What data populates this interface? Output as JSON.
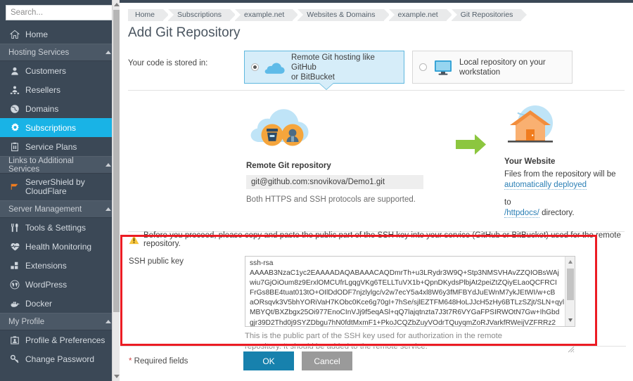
{
  "sidebar": {
    "search": {
      "placeholder": "Search...",
      "value": ""
    },
    "items": [
      {
        "type": "item",
        "label": "Home",
        "icon": "home-icon",
        "active": false
      },
      {
        "type": "group",
        "label": "Hosting Services",
        "icon": "chevron-up-icon"
      },
      {
        "type": "item",
        "label": "Customers",
        "icon": "user-icon",
        "active": false
      },
      {
        "type": "item",
        "label": "Resellers",
        "icon": "users-icon",
        "active": false
      },
      {
        "type": "item",
        "label": "Domains",
        "icon": "globe-icon",
        "active": false
      },
      {
        "type": "item",
        "label": "Subscriptions",
        "icon": "gear-icon",
        "active": true
      },
      {
        "type": "item",
        "label": "Service Plans",
        "icon": "clipboard-icon",
        "active": false
      },
      {
        "type": "group",
        "label": "Links to Additional Services",
        "icon": "chevron-up-icon"
      },
      {
        "type": "item",
        "label": "ServerShield by CloudFlare",
        "icon": "flag-icon",
        "active": false
      },
      {
        "type": "group",
        "label": "Server Management",
        "icon": "chevron-up-icon"
      },
      {
        "type": "item",
        "label": "Tools & Settings",
        "icon": "tools-icon",
        "active": false
      },
      {
        "type": "item",
        "label": "Health Monitoring",
        "icon": "heartbeat-icon",
        "active": false
      },
      {
        "type": "item",
        "label": "Extensions",
        "icon": "blocks-icon",
        "active": false
      },
      {
        "type": "item",
        "label": "WordPress",
        "icon": "wordpress-icon",
        "active": false
      },
      {
        "type": "item",
        "label": "Docker",
        "icon": "docker-icon",
        "active": false
      },
      {
        "type": "group",
        "label": "My Profile",
        "icon": "chevron-up-icon"
      },
      {
        "type": "item",
        "label": "Profile & Preferences",
        "icon": "profile-icon",
        "active": false
      },
      {
        "type": "item",
        "label": "Change Password",
        "icon": "key-icon",
        "active": false
      }
    ]
  },
  "breadcrumb": [
    "Home",
    "Subscriptions",
    "example.net",
    "Websites & Domains",
    "example.net",
    "Git Repositories"
  ],
  "page": {
    "title": "Add Git Repository"
  },
  "stored_in": {
    "label": "Your code is stored in:",
    "options": [
      {
        "label_line1": "Remote Git hosting like GitHub",
        "label_line2": "or BitBucket",
        "icon": "cloud-icon",
        "selected": true
      },
      {
        "label_line1": "Local repository on your",
        "label_line2": "workstation",
        "icon": "monitor-icon",
        "selected": false
      }
    ]
  },
  "illustration": {
    "remote": {
      "icon": "git-cloud-icon",
      "title": "Remote Git repository",
      "url": "git@github.com:snovikova/Demo1.git",
      "note": "Both HTTPS and SSH protocols are supported."
    },
    "arrow_icon": "arrow-right-icon",
    "website": {
      "icon": "house-globe-icon",
      "title": "Your Website",
      "line1": "Files from the repository will be",
      "link1": "automatically deployed",
      "line2": "to",
      "link2": "/httpdocs/",
      "line3": " directory."
    }
  },
  "warning": {
    "icon": "warning-triangle-icon",
    "text": "Before you proceed, please copy and paste the public part of the SSH key into your service (GitHub or BitBucket) used for the remote repository."
  },
  "ssh": {
    "label": "SSH public key",
    "key_lines": [
      "ssh-rsa",
      "AAAAB3NzaC1yc2EAAAADAQABAAACAQDmrTh+u3LRydr3W9Q+Stp3NMSVHAvZZQIOBsWAj",
      "wiu7GjOiOum8z9ErxlOMCUfrLgqgVKg6TELLTuVX1b+QpnDKydsPlbjAt2peiZtZQiyELaoQCFRCI",
      "FrGs8BE4tuat013tO+OIlDdODF7njzlylgc/v2w7ecY5a4xl8W6y3fMFBYdJuEWnM7ykJEtWI/w+cB",
      "aORsqvk3V5bhYORiVaH7KObc0Kce6g70gI+7hSe/sjlEZTFM648HoLJJcH5zHy6BTLzSZjt/SLN+qyl",
      "MBYQt/BXZbgx25Oi977EnoCInVJj9f5eqASl+qQ7lajqtnzta7J3t7R6VYGaFPSIRWOtN7Gw+IhGbd",
      "gjr39D2Thd0j9SYZDbgu7hN0fdtMxmF1+PkoJCQZbZuyVOdrTQuyqmZoRJVarkfRWeijVZFRRz2"
    ],
    "help_line1": "This is the public part of the SSH key used for authorization in the remote",
    "help_line2": "repository. It should be added to the remote service."
  },
  "footer": {
    "required_star": "*",
    "required_text": " Required fields",
    "ok_label": "OK",
    "cancel_label": "Cancel"
  },
  "colors": {
    "sidebar_bg": "#3b4856",
    "sidebar_group_bg": "#4b5866",
    "accent_active": "#19b3e6",
    "primary_button": "#1781ad",
    "cancel_button": "#9a9a9a",
    "highlight_red": "#ec1c24",
    "link_blue": "#2a7fb5",
    "arrow_green": "#8cc63f",
    "selected_card_bg": "#d6edf9",
    "selected_card_border": "#5fb8de"
  }
}
